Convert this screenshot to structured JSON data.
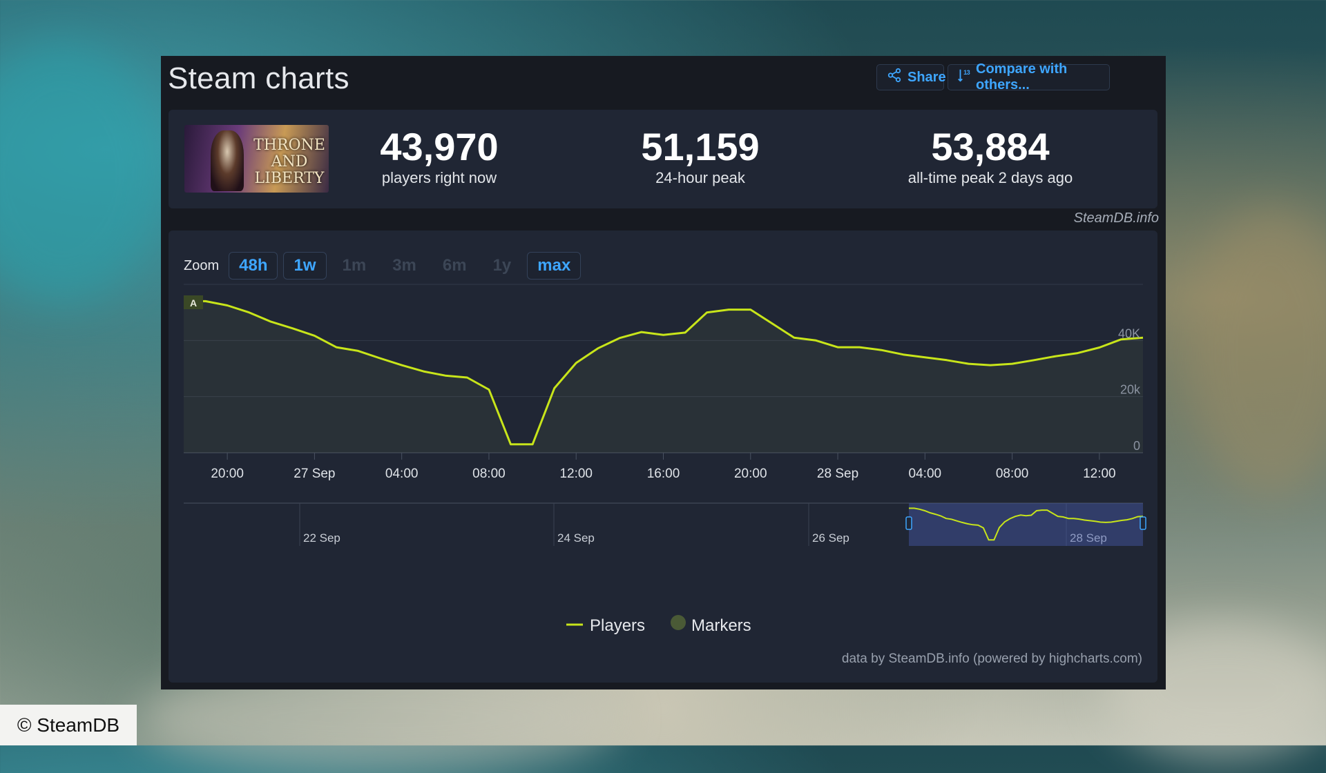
{
  "window": {
    "title": "Steam charts"
  },
  "toolbar": {
    "share_label": "Share",
    "compare_label": "Compare with others..."
  },
  "game": {
    "cover_logo_text": "THRONE AND LIBERTY"
  },
  "stats": [
    {
      "value": "43,970",
      "label": "players right now"
    },
    {
      "value": "51,159",
      "label": "24-hour peak"
    },
    {
      "value": "53,884",
      "label": "all-time peak 2 days ago"
    }
  ],
  "credit_top": "SteamDB.info",
  "zoom": {
    "label": "Zoom",
    "options": [
      {
        "label": "48h",
        "active": true
      },
      {
        "label": "1w",
        "active": true
      },
      {
        "label": "1m",
        "active": false
      },
      {
        "label": "3m",
        "active": false
      },
      {
        "label": "6m",
        "active": false
      },
      {
        "label": "1y",
        "active": false
      },
      {
        "label": "max",
        "active": true
      }
    ]
  },
  "chart_data": {
    "type": "area",
    "x_labels": [
      "20:00",
      "27 Sep",
      "04:00",
      "08:00",
      "12:00",
      "16:00",
      "20:00",
      "28 Sep",
      "04:00",
      "08:00",
      "12:00"
    ],
    "x_tick_hours": [
      0,
      4,
      8,
      12,
      16,
      20,
      24,
      28,
      32,
      36,
      40
    ],
    "xlim_hours": [
      -2,
      42
    ],
    "y_ticks": [
      "0",
      "20k",
      "40K"
    ],
    "y_tick_values": [
      0,
      20000,
      40000
    ],
    "ylim": [
      0,
      60000
    ],
    "series": [
      {
        "name": "Players",
        "color": "#c8e51a",
        "x_hours": [
          -2,
          -1,
          0,
          1,
          2,
          3,
          4,
          5,
          6,
          7,
          8,
          9,
          10,
          11,
          12,
          13,
          14,
          15,
          16,
          17,
          18,
          19,
          20,
          21,
          22,
          23,
          24,
          25,
          26,
          27,
          28,
          29,
          30,
          31,
          32,
          33,
          34,
          35,
          36,
          37,
          38,
          39,
          40,
          41,
          42
        ],
        "values": [
          54000,
          54000,
          52500,
          50000,
          46700,
          44300,
          41700,
          37600,
          36300,
          33700,
          31200,
          29000,
          27500,
          26800,
          22500,
          3000,
          3000,
          23000,
          32000,
          37200,
          40900,
          43000,
          42000,
          42800,
          50000,
          51000,
          51000,
          46000,
          41000,
          40000,
          37600,
          37600,
          36600,
          35000,
          34000,
          33000,
          31700,
          31200,
          31700,
          33000,
          34400,
          35500,
          37500,
          40400,
          41000
        ]
      }
    ],
    "navigator": {
      "labels": [
        "22 Sep",
        "24 Sep",
        "26 Sep",
        "28 Sep"
      ]
    },
    "marker_flag": "A",
    "legend": [
      {
        "name": "Players",
        "color": "#c8e51a"
      },
      {
        "name": "Markers",
        "color": "#4a5a36"
      }
    ],
    "legend_position": "bottom",
    "grid": true
  },
  "credit_bottom": "data by SteamDB.info (powered by highcharts.com)",
  "watermark": "© SteamDB"
}
